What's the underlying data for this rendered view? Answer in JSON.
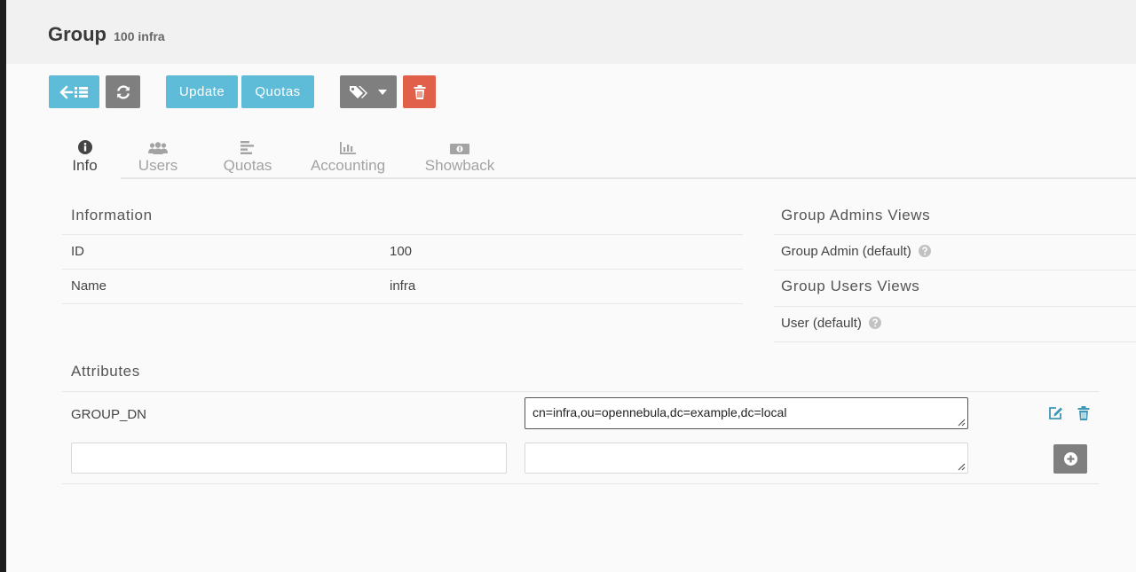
{
  "header": {
    "title": "Group",
    "subtitle": "100 infra"
  },
  "toolbar": {
    "back_list": "back-to-list",
    "refresh": "refresh",
    "update_label": "Update",
    "quotas_label": "Quotas",
    "labels": "labels-dropdown",
    "delete": "delete"
  },
  "tabs": [
    {
      "label": "Info",
      "icon": "info-icon",
      "active": true
    },
    {
      "label": "Users",
      "icon": "users-icon"
    },
    {
      "label": "Quotas",
      "icon": "quotas-icon"
    },
    {
      "label": "Accounting",
      "icon": "bar-chart-icon"
    },
    {
      "label": "Showback",
      "icon": "money-icon"
    }
  ],
  "information": {
    "title": "Information",
    "rows": [
      {
        "key": "ID",
        "value": "100"
      },
      {
        "key": "Name",
        "value": "infra"
      }
    ]
  },
  "admin_views": {
    "title": "Group Admins Views",
    "items": [
      "Group Admin (default)"
    ]
  },
  "user_views": {
    "title": "Group Users Views",
    "items": [
      "User (default)"
    ]
  },
  "attributes": {
    "title": "Attributes",
    "rows": [
      {
        "key": "GROUP_DN",
        "value": "cn=infra,ou=opennebula,dc=example,dc=local"
      }
    ],
    "new_key": "",
    "new_value": ""
  },
  "colors": {
    "accent": "#5fbcd8",
    "gray": "#7f7f7f",
    "danger": "#e0604a"
  }
}
